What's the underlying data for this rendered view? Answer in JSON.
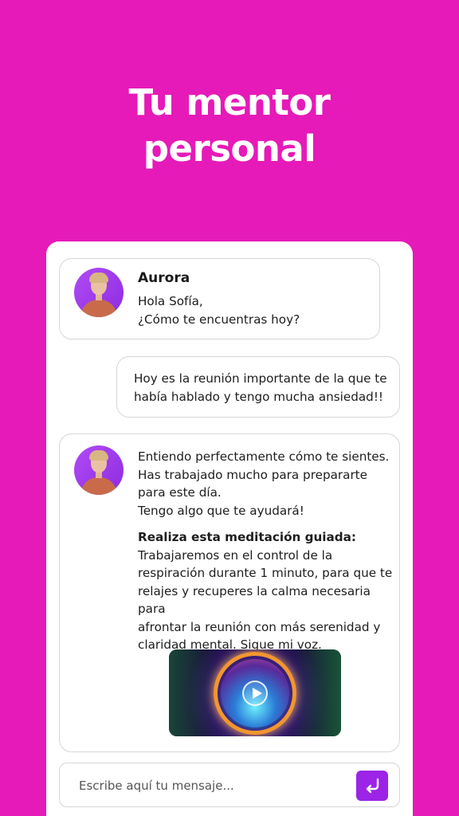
{
  "headline": {
    "line1": "Tu mentor",
    "line2": "personal"
  },
  "messages": {
    "m1": {
      "sender": "Aurora",
      "line1": "Hola Sofía,",
      "line2": "¿Cómo te encuentras hoy?"
    },
    "m2": {
      "line1": "Hoy es la reunión importante de la que te",
      "line2": "había hablado y tengo mucha ansiedad!!"
    },
    "m3": {
      "p1": [
        "Entiendo perfectamente cómo te sientes.",
        "Has trabajado mucho para prepararte",
        "para este día.",
        "Tengo algo que te ayudará!"
      ],
      "bold": "Realiza esta meditación guiada:",
      "p2": [
        "Trabajaremos en el control de la",
        "respiración durante 1 minuto, para que te",
        "relajes y recuperes la calma necesaria para",
        "afrontar la reunión con más serenidad y",
        "claridad mental. Sigue mi voz."
      ]
    }
  },
  "input": {
    "placeholder": "Escribe aquí tu mensaje..."
  },
  "icons": {
    "send": "return-arrow-icon",
    "play": "play-icon"
  },
  "colors": {
    "background": "#e61ab8",
    "send_button": "#9b24e6"
  }
}
